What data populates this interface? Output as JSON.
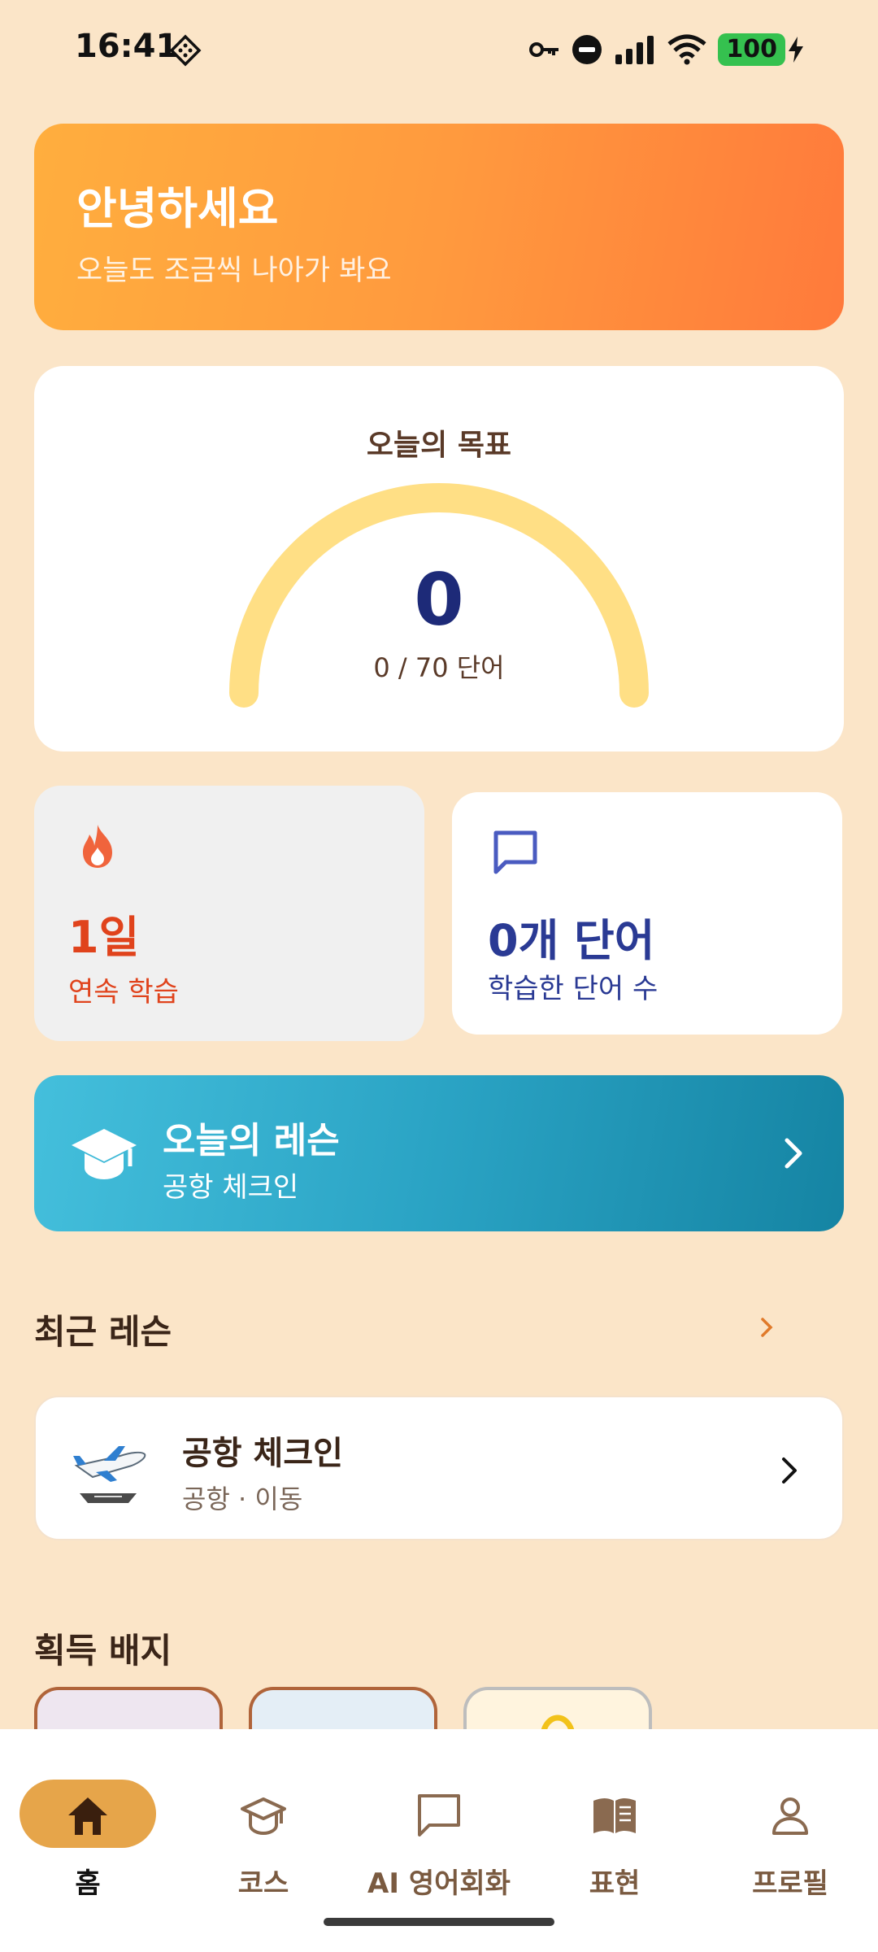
{
  "status_bar": {
    "time": "16:41",
    "battery": "100",
    "icons": [
      "diamond-grid-icon",
      "key-icon",
      "do-not-disturb-icon",
      "signal-icon",
      "wifi-icon",
      "battery-icon",
      "charging-bolt-icon"
    ]
  },
  "greeting": {
    "title": "안녕하세요",
    "subtitle": "오늘도 조금씩 나아가 봐요"
  },
  "goal": {
    "title": "오늘의 목표",
    "value": "0",
    "progress_text": "0 / 70 단어",
    "progress_fraction": 0,
    "gauge_color": "#FFDF85"
  },
  "stats": {
    "streak": {
      "value": "1일",
      "label": "연속 학습",
      "icon": "flame-icon",
      "color": "#E0431C"
    },
    "words": {
      "value": "0개 단어",
      "label": "학습한 단어 수",
      "icon": "chat-bubble-icon",
      "color": "#2A3A94"
    }
  },
  "today_lesson": {
    "title": "오늘의 레슨",
    "subtitle": "공항 체크인",
    "icon": "graduation-cap-icon"
  },
  "recent": {
    "section_title": "최근 레슨",
    "more_icon": "chevron-right-icon",
    "items": [
      {
        "name": "공항 체크인",
        "category": "공항 · 이동",
        "thumbnail": "airplane-icon"
      }
    ]
  },
  "badges": {
    "section_title": "획득 배지"
  },
  "bottom_nav": {
    "items": [
      {
        "label": "홈",
        "icon": "home-icon",
        "active": true
      },
      {
        "label": "코스",
        "icon": "graduation-cap-icon",
        "active": false
      },
      {
        "label": "AI 영어회화",
        "icon": "chat-bubble-icon",
        "active": false
      },
      {
        "label": "표현",
        "icon": "book-icon",
        "active": false
      },
      {
        "label": "프로필",
        "icon": "person-icon",
        "active": false
      }
    ]
  },
  "colors": {
    "background": "#FBE5C8",
    "accent_orange": "#FF8A3D",
    "accent_teal": "#2AA3C4",
    "nav_active": "#E6A54A"
  }
}
